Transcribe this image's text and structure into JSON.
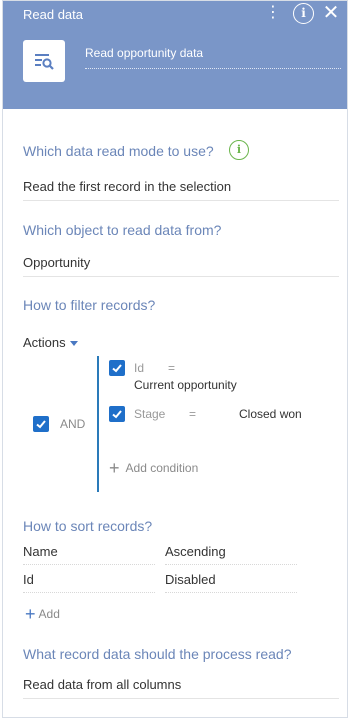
{
  "header": {
    "title": "Read data",
    "element_name": "Read opportunity data",
    "icons": {
      "more": "more-vertical-icon",
      "info": "info-icon",
      "close": "close-icon",
      "element": "read-data-icon"
    },
    "colors": {
      "header_bg": "#7a96c8"
    }
  },
  "read_mode": {
    "title": "Which data read mode to use?",
    "value": "Read the first record in the selection",
    "hint_icon": "info-icon"
  },
  "object": {
    "title": "Which object to read data from?",
    "value": "Opportunity"
  },
  "filter": {
    "title": "How to filter records?",
    "actions_label": "Actions",
    "group_operator": "AND",
    "conditions": [
      {
        "column": "Id",
        "operator": "=",
        "value": "Current opportunity",
        "checked": true
      },
      {
        "column": "Stage",
        "operator": "=",
        "value": "Closed won",
        "checked": true
      }
    ],
    "add_condition_label": "Add condition"
  },
  "sort": {
    "title": "How to sort records?",
    "rows": [
      {
        "column": "Name",
        "direction": "Ascending"
      },
      {
        "column": "Id",
        "direction": "Disabled"
      }
    ],
    "add_label": "Add"
  },
  "columns": {
    "title": "What record data should the process read?",
    "value": "Read data from all columns"
  },
  "colors": {
    "accent": "#1f6fc9",
    "section_title": "#6b86b8",
    "hint_green": "#6bb54d"
  }
}
